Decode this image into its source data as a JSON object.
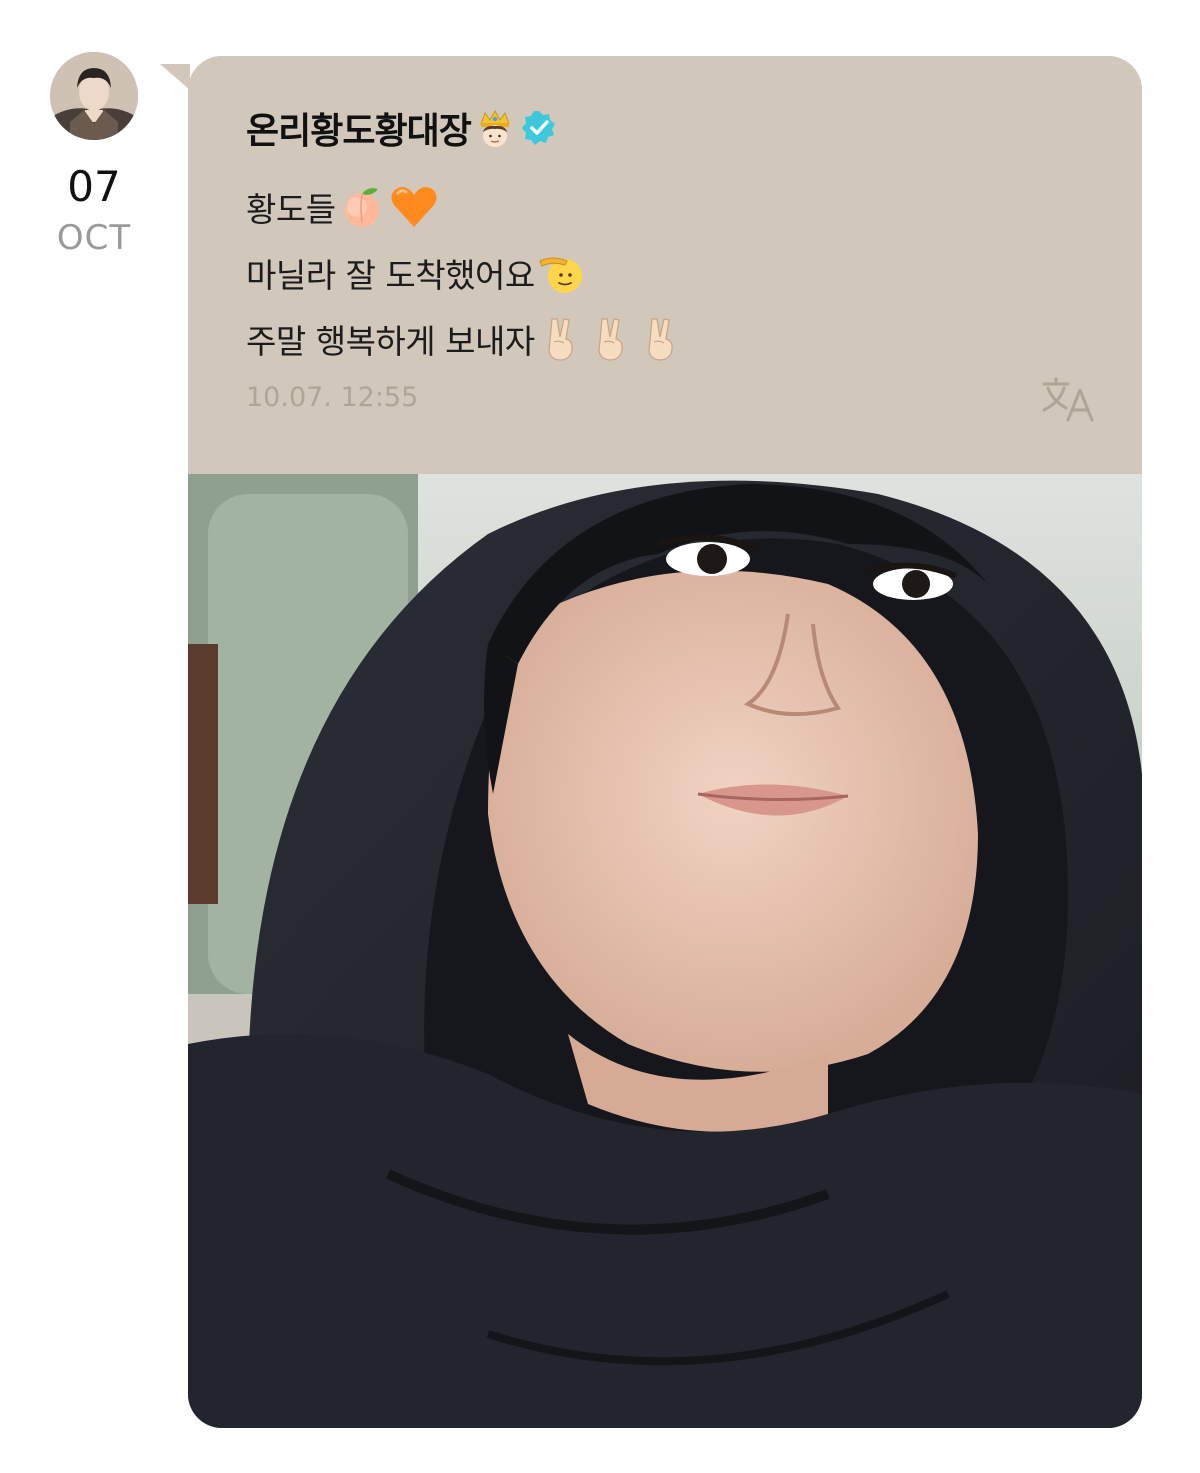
{
  "post": {
    "date_day": "07",
    "date_month": "OCT",
    "author": "온리황도황대장",
    "author_emoji": "prince-crown-emoji",
    "verified": "verified-badge-icon",
    "lines": [
      {
        "text": "황도들",
        "emojis": [
          "peach-emoji",
          "orange-heart-emoji"
        ]
      },
      {
        "text": "마닐라 잘 도착했어요",
        "emojis": [
          "saluting-face-emoji"
        ]
      },
      {
        "text": "주말 행복하게 보내자",
        "emojis": [
          "victory-hand-emoji",
          "victory-hand-emoji",
          "victory-hand-emoji"
        ]
      }
    ],
    "timestamp": "10.07. 12:55",
    "translate_icon": "translate-icon"
  },
  "colors": {
    "bubble": "#d1c7ba",
    "timestamp": "#aea597",
    "verified": "#3ec8dc",
    "date_month": "#9a9a9a"
  }
}
